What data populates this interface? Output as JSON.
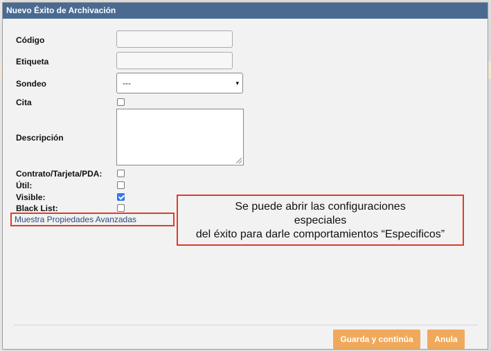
{
  "dialog": {
    "title": "Nuevo Éxito de Archivación"
  },
  "form": {
    "codigo_label": "Código",
    "codigo_value": "",
    "etiqueta_label": "Etiqueta",
    "etiqueta_value": "",
    "sondeo_label": "Sondeo",
    "sondeo_selected": "---",
    "cita_label": "Cita",
    "cita_checked": false,
    "descripcion_label": "Descripción",
    "descripcion_value": "",
    "contrato_label": "Contrato/Tarjeta/PDA:",
    "contrato_checked": false,
    "util_label": "Útil:",
    "util_checked": false,
    "visible_label": "Visible:",
    "visible_checked": true,
    "blacklist_label": "Black List:",
    "blacklist_checked": false
  },
  "advanced_link": "Muestra Propiedades Avanzadas",
  "callout": {
    "line1": "Se puede abrir las configuraciones",
    "line2": "especiales",
    "line3": "del éxito para darle comportamientos “Especificos”"
  },
  "buttons": {
    "save_continue": "Guarda y continúa",
    "cancel": "Anula"
  },
  "colors": {
    "titlebar": "#4a6a92",
    "button": "#f0a95a",
    "highlight_border": "#e03a2a",
    "checkbox_checked": "#3478f6"
  }
}
